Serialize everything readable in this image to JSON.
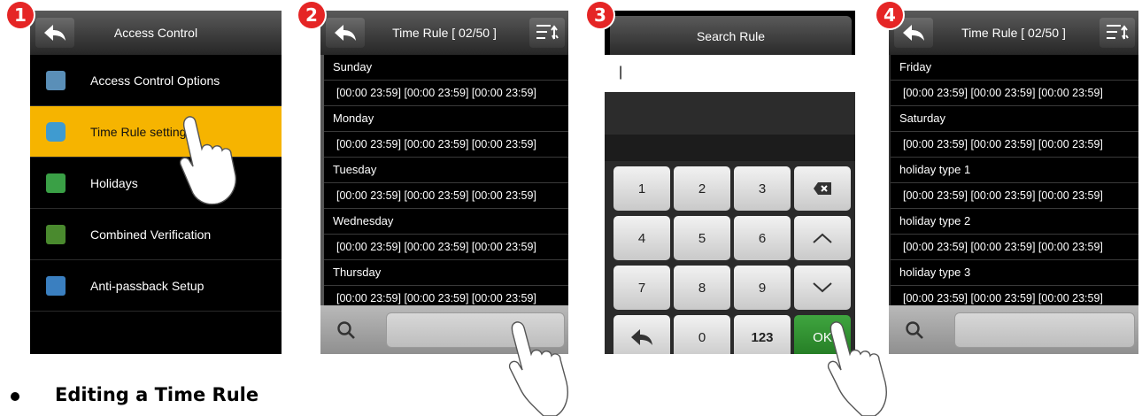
{
  "steps": [
    "1",
    "2",
    "3",
    "4"
  ],
  "screen1": {
    "title": "Access Control",
    "items": [
      {
        "label": "Access Control Options",
        "color": "#5a8fb8"
      },
      {
        "label": "Time Rule setting",
        "color": "#3f9bd0"
      },
      {
        "label": "Holidays",
        "color": "#3aa046"
      },
      {
        "label": "Combined Verification",
        "color": "#4a8a2e"
      },
      {
        "label": "Anti-passback Setup",
        "color": "#3a7fc0"
      }
    ]
  },
  "screen2": {
    "title": "Time Rule [ 02/50 ]",
    "rows": [
      {
        "name": "Sunday",
        "value": "[00:00 23:59] [00:00 23:59] [00:00 23:59]"
      },
      {
        "name": "Monday",
        "value": "[00:00 23:59] [00:00 23:59] [00:00 23:59]"
      },
      {
        "name": "Tuesday",
        "value": "[00:00 23:59] [00:00 23:59] [00:00 23:59]"
      },
      {
        "name": "Wednesday",
        "value": "[00:00 23:59] [00:00 23:59] [00:00 23:59]"
      },
      {
        "name": "Thursday",
        "value": "[00:00 23:59] [00:00 23:59] [00:00 23:59]"
      }
    ]
  },
  "screen3": {
    "title": "Search Rule",
    "input_value": "|",
    "keys": [
      "1",
      "2",
      "3",
      "4",
      "5",
      "6",
      "7",
      "8",
      "9",
      "0",
      "123",
      "OK"
    ]
  },
  "screen4": {
    "title": "Time Rule [ 02/50 ]",
    "rows": [
      {
        "name": "Friday",
        "value": "[00:00 23:59] [00:00 23:59] [00:00 23:59]"
      },
      {
        "name": "Saturday",
        "value": "[00:00 23:59] [00:00 23:59] [00:00 23:59]"
      },
      {
        "name": "holiday type 1",
        "value": "[00:00 23:59] [00:00 23:59] [00:00 23:59]"
      },
      {
        "name": "holiday type 2",
        "value": "[00:00 23:59] [00:00 23:59] [00:00 23:59]"
      },
      {
        "name": "holiday type 3",
        "value": "[00:00 23:59] [00:00 23:59] [00:00 23:59]"
      }
    ]
  },
  "caption": "Editing a Time Rule",
  "colors": {
    "highlight": "#f6b400",
    "ok_key": "#2f8f2f",
    "badge": "#e52525"
  }
}
